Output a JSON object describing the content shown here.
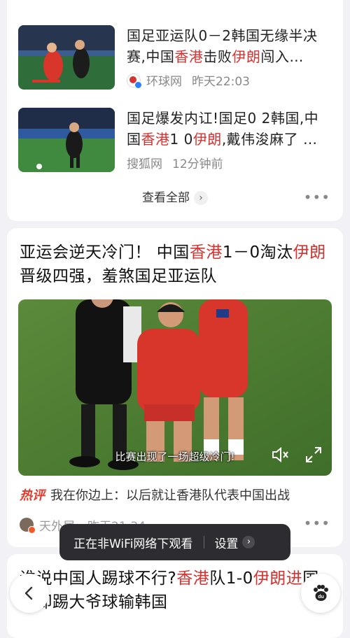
{
  "card1": {
    "item1": {
      "title_parts": [
        "国足亚运队0－2韩国无缘半决赛,中国",
        "香港",
        "击败",
        "伊朗",
        "闯入…"
      ],
      "source": "环球网",
      "time": "昨天22:03"
    },
    "item2": {
      "title_parts": [
        "国足爆发内讧!国足0 2韩国,中国",
        "香港",
        "1 0",
        "伊朗",
        ",戴伟浚麻了 …"
      ],
      "source": "搜狐网",
      "time": "12分钟前"
    },
    "view_all_label": "查看全部",
    "more_label": "•••"
  },
  "card2": {
    "title_parts": [
      "亚运会逆天冷门！ 中国",
      "香港",
      "1－0淘汰",
      "伊朗",
      "晋级四强，羞煞国足亚运队"
    ],
    "video_subtitle": "比赛出现了一场超级冷门!",
    "hot_badge": "热评",
    "hot_comment": "我在你边上：以后就让香港队代表中国出战",
    "author": "天外居",
    "time": "昨天21:34",
    "more_label": "•••"
  },
  "card3": {
    "title_parts": [
      "谁说中国人踢球不行?",
      "香港",
      "队1-0",
      "伊朗",
      "进",
      "国足却踢大爷球输韩国"
    ]
  },
  "toast": {
    "message": "正在非WiFi网络下观看",
    "settings_label": "设置"
  },
  "colors": {
    "highlight": "#d6322f",
    "toast_bg": "#2d2d31",
    "page_bg": "#f2f2f6"
  },
  "icons": [
    "mute-icon",
    "fullscreen-icon",
    "back-icon",
    "paw-du-icon",
    "chevron-right-icon"
  ]
}
